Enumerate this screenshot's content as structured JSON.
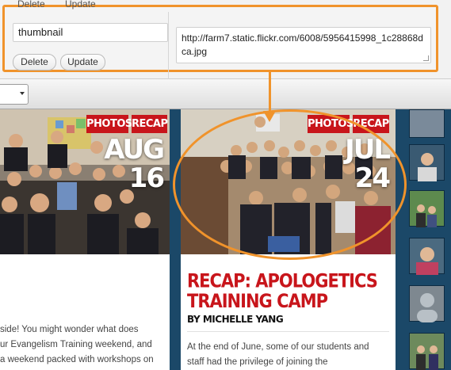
{
  "admin": {
    "top_delete_label": "Delete",
    "top_update_label": "Update",
    "meta_key_value": "thumbnail",
    "delete_label": "Delete",
    "update_label": "Update",
    "meta_value": "http://farm7.static.flickr.com/6008/5956415998_1c28868dca.jpg"
  },
  "posts": {
    "left": {
      "tag_photos": "PHOTOS",
      "tag_recap": "RECAP",
      "month": "AUG",
      "day": "16",
      "excerpt_lines": [
        "side! You might wonder what does",
        "ur Evangelism Training weekend, and",
        "a weekend packed with workshops on"
      ]
    },
    "mid": {
      "tag_photos": "PHOTOS",
      "tag_recap": "RECAP",
      "month": "JUL",
      "day": "24",
      "title_line1": "RECAP: APOLOGETICS",
      "title_line2": "TRAINING CAMP",
      "byline": "BY MICHELLE YANG",
      "excerpt_line1": "At the end of June, some of our students and",
      "excerpt_line2": "staff had the privilege of  joining the"
    }
  },
  "colors": {
    "accent": "#f0932b",
    "tag_red": "#c8151b",
    "background_blue": "#1b4868"
  }
}
